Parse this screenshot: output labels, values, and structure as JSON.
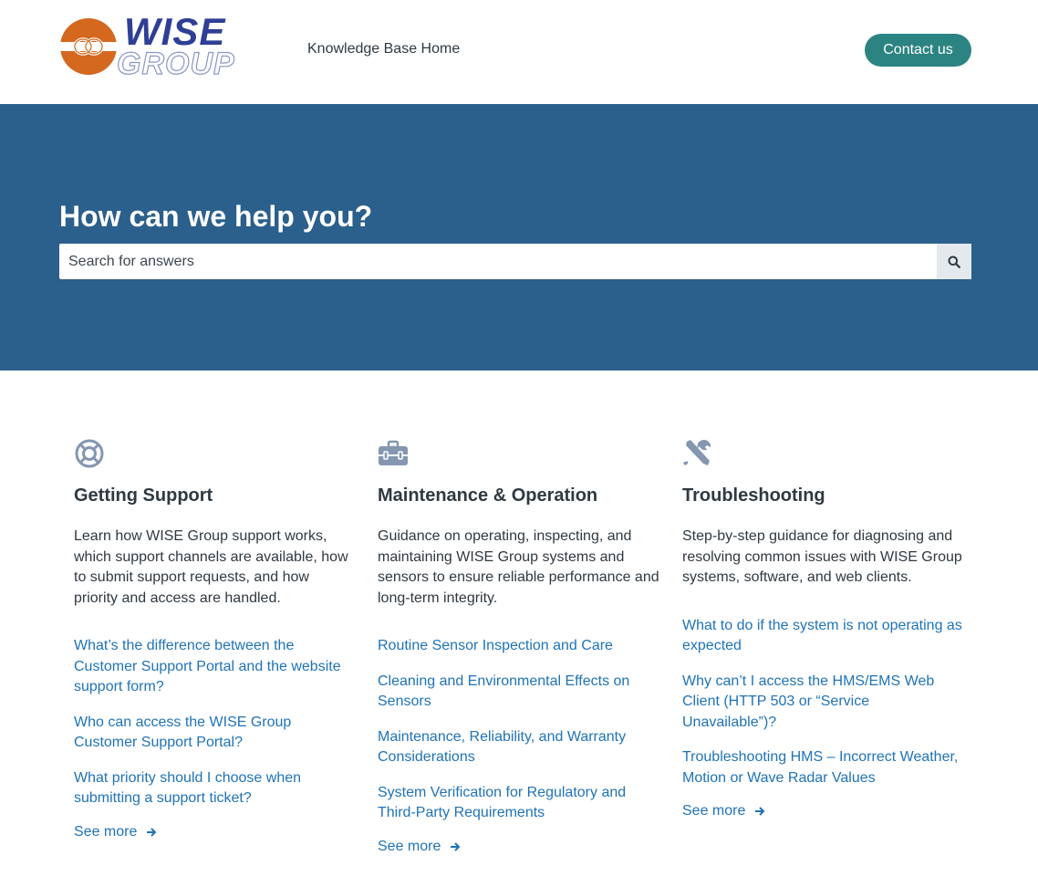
{
  "header": {
    "logo_top": "WISE",
    "logo_bottom": "GROUP",
    "nav_link": "Knowledge Base Home",
    "contact_label": "Contact us",
    "colors": {
      "brand_orange": "#d4681f",
      "brand_blue": "#2e3f95",
      "button": "#2c8482"
    }
  },
  "hero": {
    "title": "How can we help you?",
    "search_placeholder": "Search for answers",
    "search_icon": "search-icon",
    "background": "#2b5f8c"
  },
  "categories": [
    {
      "icon": "lifebuoy-icon",
      "title": "Getting Support",
      "description": "Learn how WISE Group support works, which support channels are available, how to submit support requests, and how priority and access are handled.",
      "articles": [
        "What’s the difference between the Customer Support Portal and the website support form?",
        "Who can access the WISE Group Customer Support Portal?",
        "What priority should I choose when submitting a support ticket?"
      ],
      "see_more": "See more"
    },
    {
      "icon": "toolbox-icon",
      "title": "Maintenance & Operation",
      "description": "Guidance on operating, inspecting, and maintaining WISE Group systems and sensors to ensure reliable performance and long-term integrity.",
      "articles": [
        "Routine Sensor Inspection and Care",
        "Cleaning and Environmental Effects on Sensors",
        "Maintenance, Reliability, and Warranty Considerations",
        "System Verification for Regulatory and Third-Party Requirements"
      ],
      "see_more": "See more"
    },
    {
      "icon": "tools-icon",
      "title": "Troubleshooting",
      "description": "Step-by-step guidance for diagnosing and resolving common issues with WISE Group systems, software, and web clients.",
      "articles": [
        "What to do if the system is not operating as expected",
        "Why can’t I access the HMS/EMS Web Client (HTTP 503 or “Service Unavailable”)?",
        "Troubleshooting HMS – Incorrect Weather, Motion or Wave Radar Values"
      ],
      "see_more": "See more"
    }
  ]
}
